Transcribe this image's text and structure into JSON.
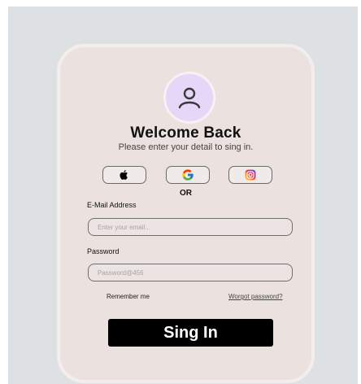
{
  "login": {
    "title": "Welcome Back",
    "subtitle": "Please enter your detail to sing in.",
    "divider": "OR",
    "email": {
      "label": "E-Mail Address",
      "placeholder": "Enter your email...",
      "value": ""
    },
    "password": {
      "label": "Password",
      "placeholder": "Password@456",
      "value": ""
    },
    "remember_label": "Remember me",
    "forgot_label": "Worgot password?",
    "submit_label": "Sing In"
  },
  "social_icons": [
    "apple-icon",
    "google-icon",
    "instagram-icon"
  ],
  "colors": {
    "background": "#dee1e3",
    "card": "#ebe2e0",
    "avatar": "#e6d6f7",
    "avatar_icon": "#3a3a3a",
    "button": "#000000"
  }
}
